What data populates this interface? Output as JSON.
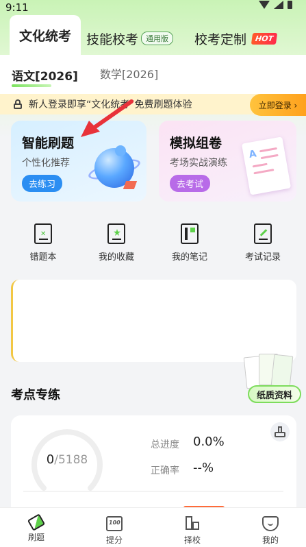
{
  "status_bar": {
    "time": "9:11"
  },
  "main_tabs": {
    "tab1": "文化统考",
    "tab2": "技能校考",
    "tab2_badge": "通用版",
    "tab3": "校考定制",
    "tab3_badge": "HOT"
  },
  "sub_tabs": {
    "tab1": "语文[2026]",
    "tab2": "数学[2026]"
  },
  "notice": {
    "text": "新人登录即享“文化统考”免费刷题体验",
    "button": "立即登录 ›"
  },
  "cards": {
    "smart": {
      "title": "智能刷题",
      "subtitle": "个性化推荐",
      "button": "去练习"
    },
    "mock": {
      "title": "模拟组卷",
      "subtitle": "考场实战演练",
      "button": "去考试"
    }
  },
  "shortcuts": {
    "wrong": "错题本",
    "favorites": "我的收藏",
    "notes": "我的笔记",
    "exam_record": "考试记录"
  },
  "paper_promo": {
    "button": "纸质资料"
  },
  "section": {
    "title": "考点专练"
  },
  "stats": {
    "done": "0",
    "total": "/5188",
    "progress_label": "总进度",
    "progress_value": "0.0%",
    "accuracy_label": "正确率",
    "accuracy_value": "--%"
  },
  "bottom_nav": {
    "practice": "刷题",
    "score": "提分",
    "school": "择校",
    "me": "我的"
  },
  "colors": {
    "accent_green": "#5ed14a",
    "practice_blue": "#2b8ef2",
    "exam_purple": "#b86be8",
    "login_orange": "#ffa11d",
    "arrow_red": "#e8323a"
  }
}
